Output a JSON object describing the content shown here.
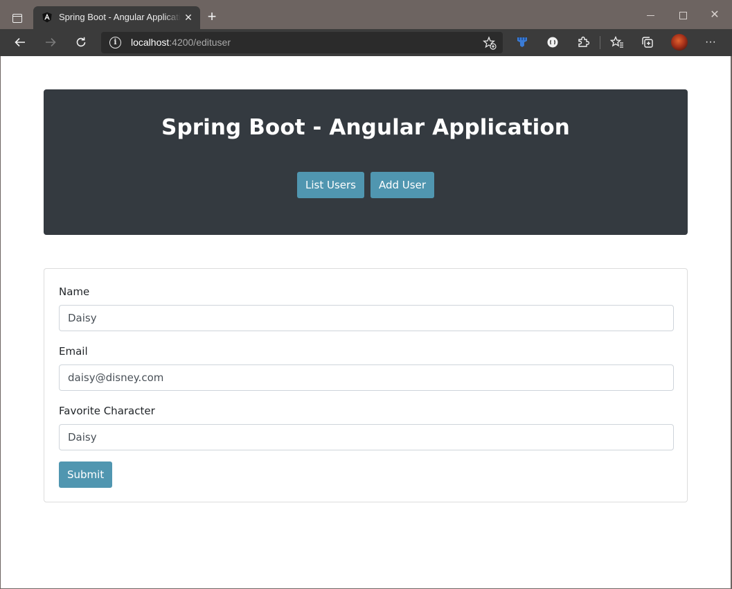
{
  "browser": {
    "tab_title": "Spring Boot - Angular Application",
    "new_tab_symbol": "+",
    "close_symbol": "✕",
    "url_host": "localhost",
    "url_rest": ":4200/edituser",
    "more_symbol": "···"
  },
  "header": {
    "title": "Spring Boot - Angular Application",
    "list_users_label": "List Users",
    "add_user_label": "Add User"
  },
  "form": {
    "name_label": "Name",
    "name_value": "Daisy",
    "email_label": "Email",
    "email_value": "daisy@disney.com",
    "character_label": "Favorite Character",
    "character_value": "Daisy",
    "submit_label": "Submit"
  },
  "colors": {
    "jumbotron_bg": "#343a40",
    "button_bg": "#5096b0",
    "tabbar_bg": "#6d6461",
    "toolbar_bg": "#3b3b3b"
  }
}
